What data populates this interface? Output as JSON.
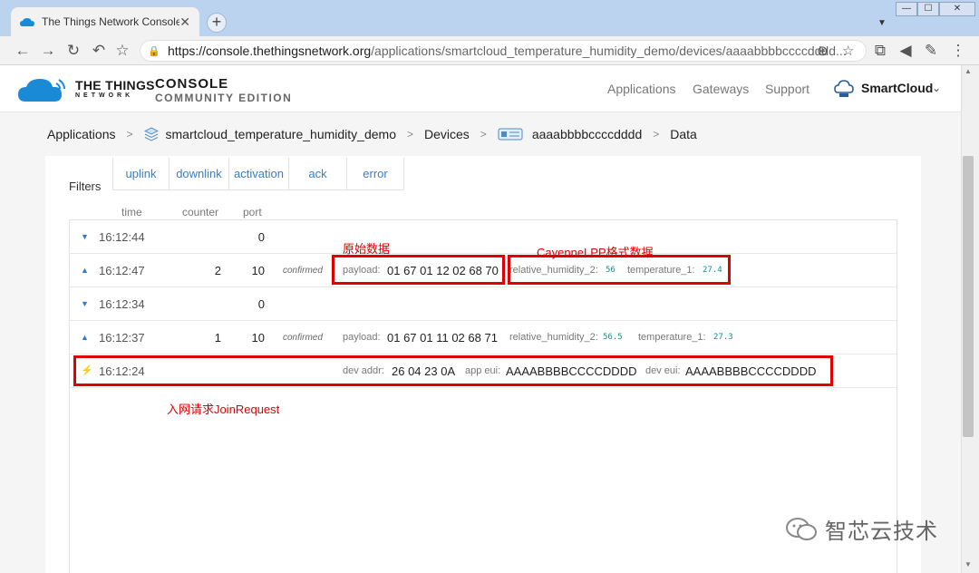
{
  "browser": {
    "tab_title": "The Things Network Console",
    "tab_close": "✕",
    "new_tab": "+",
    "url_scheme": "https://",
    "url_host": "console.thethingsnetwork.org",
    "url_path": "/applications/smartcloud_temperature_humidity_demo/devices/aaaabbbbccccdddd...",
    "window_controls": [
      "—",
      "☐",
      "✕"
    ]
  },
  "header": {
    "logo_line1": "THE THINGS",
    "logo_line2": "NETWORK",
    "console_title": "CONSOLE",
    "console_subtitle": "COMMUNITY EDITION",
    "nav": [
      "Applications",
      "Gateways",
      "Support"
    ],
    "user": "SmartCloud"
  },
  "breadcrumb": {
    "applications": "Applications",
    "app_id": "smartcloud_temperature_humidity_demo",
    "devices": "Devices",
    "device_id": "aaaabbbbccccdddd",
    "data": "Data",
    "separator": ">"
  },
  "filters": {
    "label": "Filters",
    "tabs": [
      "uplink",
      "downlink",
      "activation",
      "ack",
      "error"
    ]
  },
  "columns": {
    "time": "time",
    "counter": "counter",
    "port": "port"
  },
  "rows": [
    {
      "time": "16:12:44",
      "counter": "",
      "port": "0"
    },
    {
      "time": "16:12:47",
      "counter": "2",
      "port": "10",
      "confirmed": "confirmed",
      "payload_label": "payload:",
      "payload": "01 67 01 12 02 68 70",
      "field1_label": "relative_humidity_2:",
      "field1_value": "56",
      "field2_label": "temperature_1:",
      "field2_value": "27.4"
    },
    {
      "time": "16:12:34",
      "counter": "",
      "port": "0"
    },
    {
      "time": "16:12:37",
      "counter": "1",
      "port": "10",
      "confirmed": "confirmed",
      "payload_label": "payload:",
      "payload": "01 67 01 11 02 68 71",
      "field1_label": "relative_humidity_2:",
      "field1_value": "56.5",
      "field2_label": "temperature_1:",
      "field2_value": "27.3"
    },
    {
      "time": "16:12:24",
      "dev_addr_label": "dev addr:",
      "dev_addr": "26 04 23 0A",
      "app_eui_label": "app eui:",
      "app_eui": "AAAABBBBCCCCDDDD",
      "dev_eui_label": "dev eui:",
      "dev_eui": "AAAABBBBCCCCDDDD"
    }
  ],
  "annotations": {
    "raw": "原始数据",
    "cayenne": "CayenneLPP格式数据",
    "join": "入网请求JoinRequest"
  },
  "watermark": "智芯云技术",
  "colors": {
    "annotation": "#e00000",
    "link": "#3a7fc4",
    "arrow": "#2f7dd1"
  }
}
